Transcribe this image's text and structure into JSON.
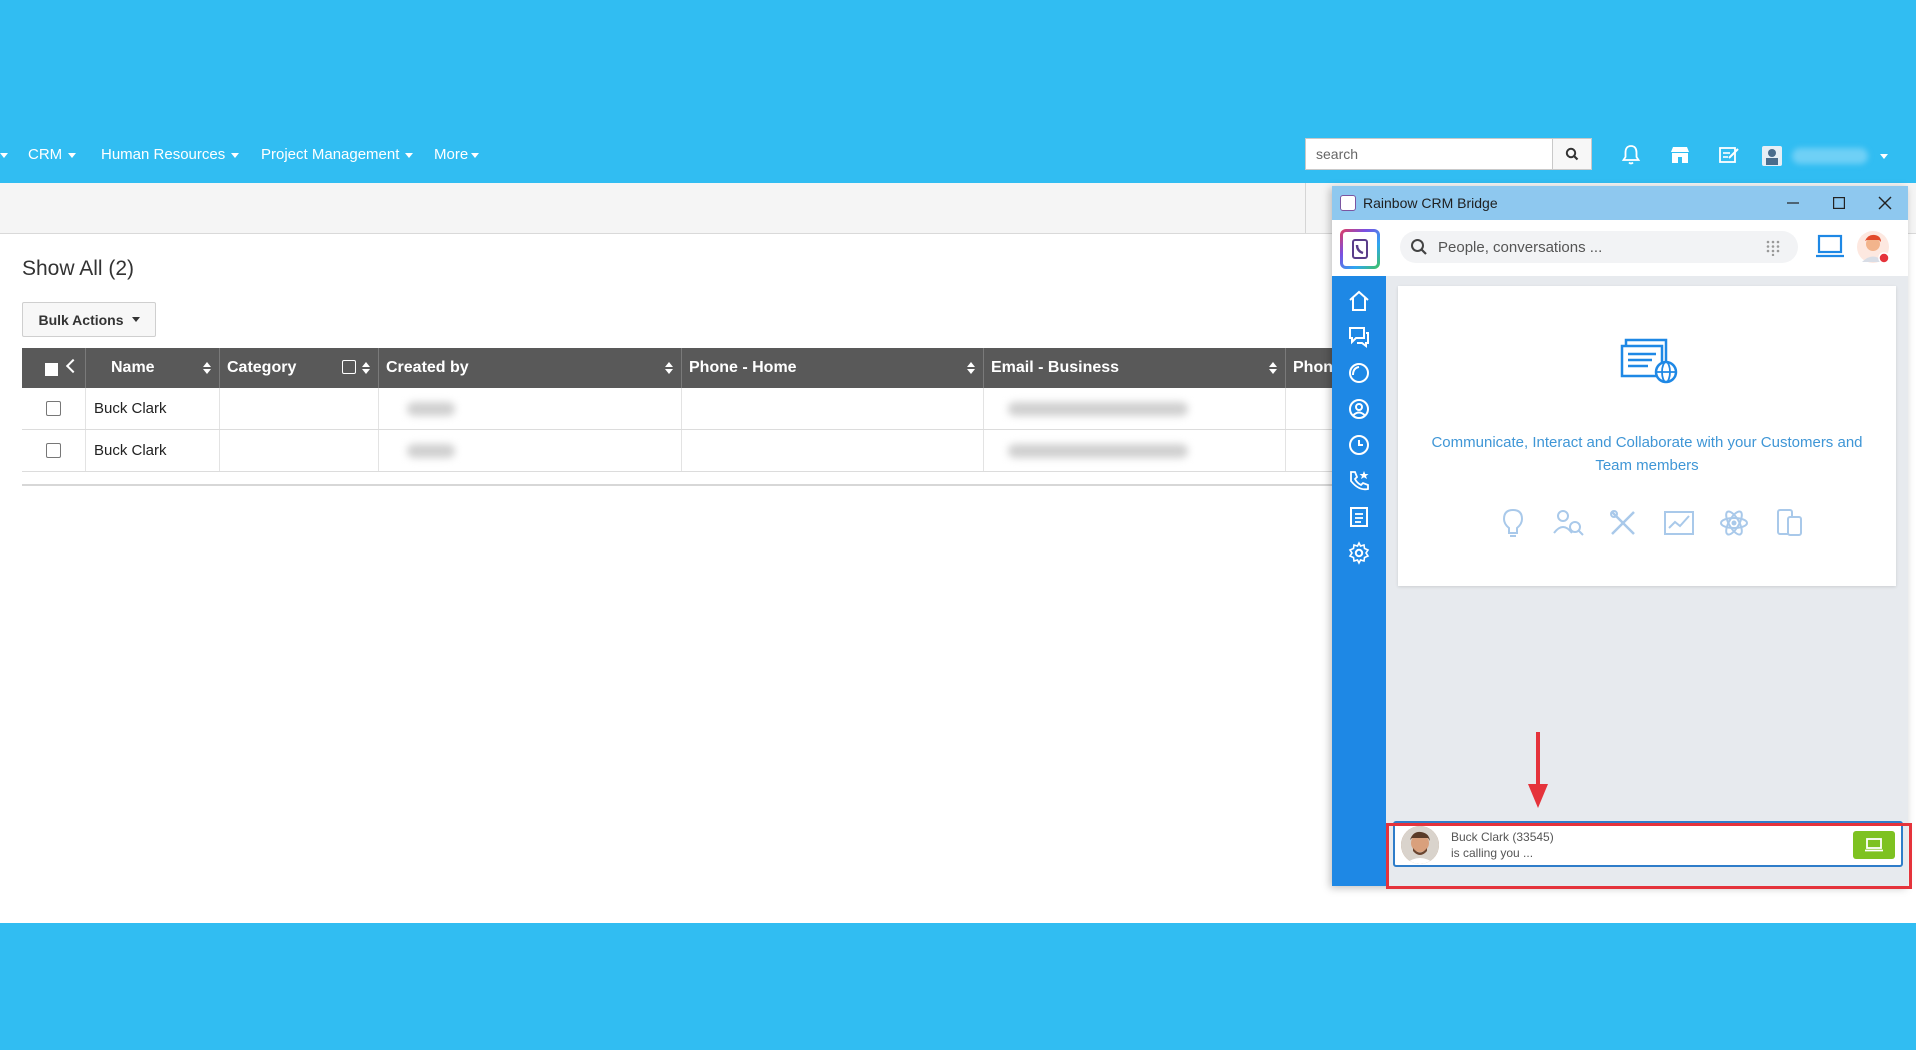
{
  "nav": {
    "items": [
      {
        "label": "CRM"
      },
      {
        "label": "Human Resources"
      },
      {
        "label": "Project Management"
      },
      {
        "label": "More"
      }
    ],
    "search_placeholder": "search"
  },
  "page": {
    "title": "Show All (2)",
    "bulk_actions_label": "Bulk Actions"
  },
  "grid": {
    "columns": [
      "Name",
      "Category",
      "Created by",
      "Phone - Home",
      "Email - Business",
      "Phon"
    ],
    "rows": [
      {
        "name": "Buck Clark",
        "category": "",
        "phone_home": ""
      },
      {
        "name": "Buck Clark",
        "category": "",
        "phone_home": ""
      }
    ]
  },
  "rainbow": {
    "window_title": "Rainbow CRM Bridge",
    "search_placeholder": "People, conversations ...",
    "welcome_text": "Communicate, Interact and Collaborate with your Customers and Team members",
    "call": {
      "caller": "Buck Clark (33545)",
      "status": "is calling you ..."
    },
    "sidebar_icons": [
      "home-icon",
      "conversations-icon",
      "bubbles-icon",
      "contacts-icon",
      "history-icon",
      "favorites-call-icon",
      "notes-icon",
      "settings-icon"
    ]
  },
  "colors": {
    "background": "#31bdf2",
    "grid_header": "#595959",
    "rainbow_sidebar": "#1e88e5",
    "rainbow_titlebar": "#8ec8ef",
    "answer_button": "#7ec221",
    "highlight": "#e5333b"
  }
}
